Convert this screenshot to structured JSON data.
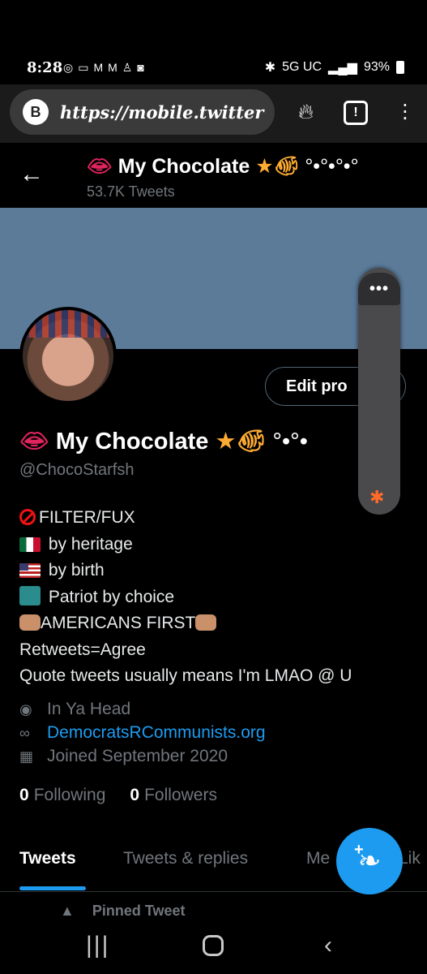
{
  "status_bar": {
    "time": "8:28",
    "network": "5G UC",
    "battery": "93%"
  },
  "browser": {
    "url": "https://mobile.twitter",
    "tab_indicator": "!"
  },
  "header": {
    "title": "My Chocolate",
    "title_suffix": "°•°•°•°",
    "tweet_count": "53.7K Tweets"
  },
  "profile": {
    "edit_button": "Edit pro",
    "display_name": "My Chocolate",
    "name_suffix": "°•°•",
    "handle": "@ChocoStarfsh",
    "bio": {
      "line1": "FILTER/FUX",
      "line2": "by heritage",
      "line3": "by birth",
      "line4": "Patriot by choice",
      "line5": "AMERICANS FIRST",
      "line6": "Retweets=Agree",
      "line7": "Quote tweets usually means I'm LMAO @ U"
    },
    "location": "In Ya Head",
    "website": "DemocratsRCommunists.org",
    "joined": "Joined September 2020",
    "following_count": "0",
    "following_label": "Following",
    "followers_count": "0",
    "followers_label": "Followers"
  },
  "tabs": {
    "tweets": "Tweets",
    "replies": "Tweets & replies",
    "media": "Me",
    "likes": "Lik"
  },
  "pinned_label": "Pinned Tweet",
  "colors": {
    "accent": "#1d9bf0",
    "banner": "#5b7b99",
    "muted_text": "#71767b"
  }
}
